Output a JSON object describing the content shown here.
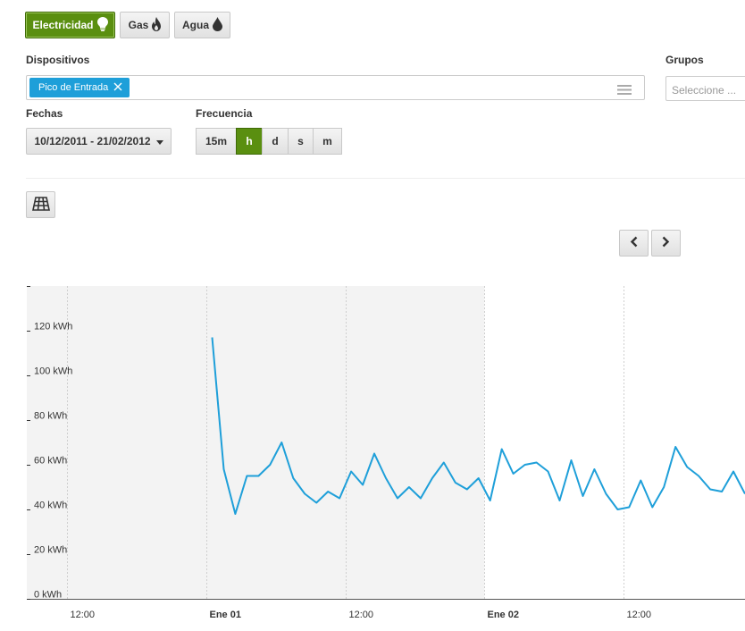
{
  "energy_tabs": [
    {
      "label": "Electricidad",
      "icon": "lightbulb-icon",
      "active": true
    },
    {
      "label": "Gas",
      "icon": "flame-icon",
      "active": false
    },
    {
      "label": "Agua",
      "icon": "water-drop-icon",
      "active": false
    }
  ],
  "devices": {
    "label": "Dispositivos",
    "selected_chip": "Pico de Entrada",
    "list_icon": "list-icon"
  },
  "groups": {
    "label": "Grupos",
    "placeholder": "Seleccione ..."
  },
  "dates": {
    "label": "Fechas",
    "range": "10/12/2011 - 21/02/2012",
    "caret_icon": "caret-down-icon"
  },
  "frequency": {
    "label": "Frecuencia",
    "options": [
      "15m",
      "h",
      "d",
      "s",
      "m"
    ],
    "selected": "h"
  },
  "grid_button_icon": "grid-table-icon",
  "nav": {
    "prev_icon": "chevron-left-icon",
    "next_icon": "chevron-right-icon"
  },
  "colors": {
    "accent": "#5a8f10",
    "chip": "#1e9fd9",
    "line": "#1e9fd9",
    "shade": "#f3f3f3"
  },
  "chart_data": {
    "type": "line",
    "unit": "kWh",
    "y_tick_labels": [
      "0 kWh",
      "20 kWh",
      "40 kWh",
      "60 kWh",
      "80 kWh",
      "100 kWh",
      "120 kWh"
    ],
    "y_ticks": [
      0,
      20,
      40,
      60,
      80,
      100,
      120
    ],
    "ylim": [
      0,
      140
    ],
    "x_tick_labels": [
      "12:00",
      "Ene 01",
      "12:00",
      "Ene 02",
      "12:00"
    ],
    "x_tick_hours": [
      -12,
      0,
      12,
      24,
      36
    ],
    "x_tick_bold": [
      false,
      true,
      false,
      true,
      false
    ],
    "x_range_hours": [
      -15.5,
      46.5
    ],
    "shaded_range_hours": [
      -15.5,
      24
    ],
    "grid": true,
    "series": [
      {
        "start_hour": 0.5,
        "step_hours": 1,
        "values": [
          117,
          58,
          38,
          55,
          55,
          60,
          70,
          54,
          47,
          43,
          48,
          45,
          57,
          51,
          65,
          54,
          45,
          50,
          45,
          54,
          61,
          52,
          49,
          54,
          44,
          67,
          56,
          60,
          61,
          57,
          44,
          62,
          46,
          58,
          47,
          40,
          41,
          53,
          41,
          50,
          68,
          59,
          55,
          49,
          48,
          57,
          47
        ]
      }
    ]
  }
}
